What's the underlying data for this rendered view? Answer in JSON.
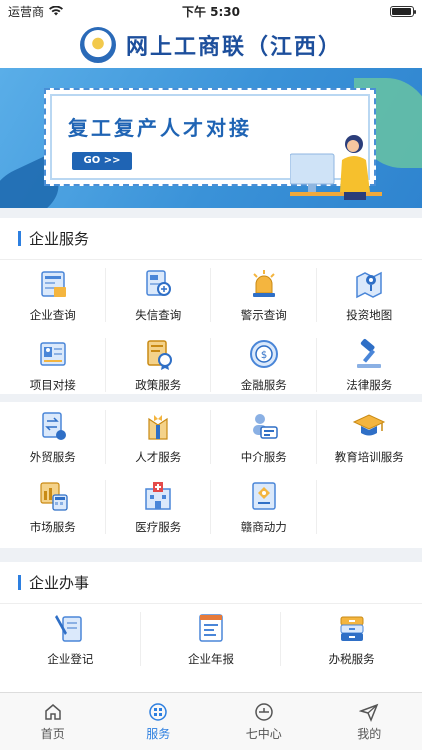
{
  "status_bar": {
    "carrier": "运营商",
    "time": "下午 5:30",
    "battery_level": 0.95
  },
  "header": {
    "title": "网上工商联（江西）"
  },
  "banner": {
    "heading": "复工复产人才对接",
    "cta": "GO >>"
  },
  "colors": {
    "accent": "#2d7fe0",
    "title_blue": "#1d4f9c"
  },
  "section_enterprise_services": {
    "title": "企业服务",
    "items": [
      {
        "label": "企业查询",
        "icon": "enterprise-search-icon"
      },
      {
        "label": "失信查询",
        "icon": "credit-search-icon"
      },
      {
        "label": "警示查询",
        "icon": "warning-light-icon"
      },
      {
        "label": "投资地图",
        "icon": "investment-map-icon"
      },
      {
        "label": "项目对接",
        "icon": "project-card-icon"
      },
      {
        "label": "政策服务",
        "icon": "policy-certificate-icon"
      },
      {
        "label": "金融服务",
        "icon": "finance-coin-icon"
      },
      {
        "label": "法律服务",
        "icon": "law-gavel-icon"
      }
    ]
  },
  "section_more_services": {
    "items": [
      {
        "label": "外贸服务",
        "icon": "foreign-trade-icon"
      },
      {
        "label": "人才服务",
        "icon": "talent-suit-icon"
      },
      {
        "label": "中介服务",
        "icon": "agency-card-icon"
      },
      {
        "label": "教育培训服务",
        "icon": "graduation-cap-icon"
      },
      {
        "label": "市场服务",
        "icon": "market-calculator-icon"
      },
      {
        "label": "医疗服务",
        "icon": "hospital-icon"
      },
      {
        "label": "赣商动力",
        "icon": "gan-merchant-icon"
      }
    ]
  },
  "section_enterprise_affairs": {
    "title": "企业办事",
    "items": [
      {
        "label": "企业登记",
        "icon": "registration-pen-icon"
      },
      {
        "label": "企业年报",
        "icon": "annual-report-icon"
      },
      {
        "label": "办税服务",
        "icon": "tax-drawer-icon"
      }
    ]
  },
  "tabbar": {
    "tabs": [
      {
        "label": "首页",
        "icon": "home-icon"
      },
      {
        "label": "服务",
        "icon": "service-icon",
        "active": true
      },
      {
        "label": "七中心",
        "icon": "center-icon"
      },
      {
        "label": "我的",
        "icon": "send-icon"
      }
    ]
  }
}
